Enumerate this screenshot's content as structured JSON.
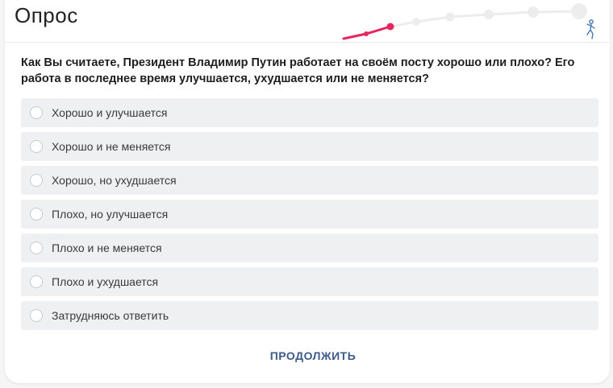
{
  "header": {
    "title": "Опрос"
  },
  "progress": {
    "current_step": 2,
    "total_steps": 7,
    "accent_color": "#e8265e",
    "inactive_color": "#ededed"
  },
  "question": {
    "text": "Как Вы считаете, Президент Владимир Путин работает на своём посту хорошо или плохо? Его работа в последнее время улучшается, ухудшается или не меняется?"
  },
  "options": [
    {
      "label": "Хорошо и улучшается",
      "selected": false
    },
    {
      "label": "Хорошо и не меняется",
      "selected": false
    },
    {
      "label": "Хорошо, но ухудшается",
      "selected": false
    },
    {
      "label": "Плохо, но улучшается",
      "selected": false
    },
    {
      "label": "Плохо и не меняется",
      "selected": false
    },
    {
      "label": "Плохо и ухудшается",
      "selected": false
    },
    {
      "label": "Затрудняюсь ответить",
      "selected": false
    }
  ],
  "footer": {
    "continue_label": "ПРОДОЛЖИТЬ"
  },
  "icons": {
    "progress_end": "runner-icon"
  }
}
